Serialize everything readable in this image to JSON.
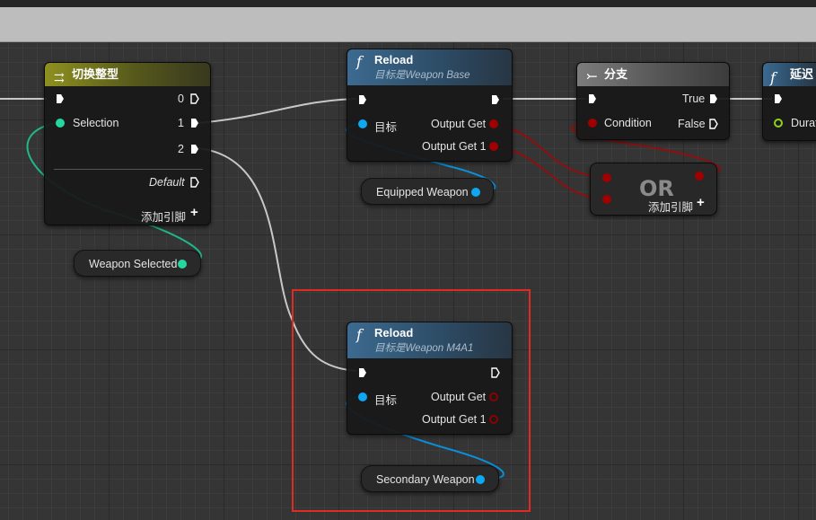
{
  "colors": {
    "exec_pin": "#ffffff",
    "object_pin": "#0fa7f1",
    "int_pin": "#26d6a0",
    "bool_pin": "#a10000",
    "float_pin": "#8bd320",
    "highlight": "#e12a23"
  },
  "switch_node": {
    "icon": "switch-int-icon",
    "title": "切换整型",
    "selection_label": "Selection",
    "out0": "0",
    "out1": "1",
    "out2": "2",
    "default_label": "Default",
    "add_pin_label": "添加引脚"
  },
  "reload_base": {
    "icon": "function-icon",
    "title": "Reload",
    "subtitle": "目标是Weapon Base",
    "target_label": "目标",
    "out_get": "Output Get",
    "out_get1": "Output Get 1"
  },
  "branch_node": {
    "icon": "branch-icon",
    "title": "分支",
    "condition_label": "Condition",
    "true_label": "True",
    "false_label": "False"
  },
  "delay_node": {
    "icon": "function-icon",
    "title": "延迟",
    "duration_label": "Durat"
  },
  "or_node": {
    "label": "OR",
    "add_pin_label": "添加引脚"
  },
  "equipped_weapon": {
    "label": "Equipped Weapon"
  },
  "weapon_selected": {
    "label": "Weapon Selected"
  },
  "reload_m4": {
    "icon": "function-icon",
    "title": "Reload",
    "subtitle": "目标是Weapon M4A1",
    "target_label": "目标",
    "out_get": "Output Get",
    "out_get1": "Output Get 1"
  },
  "secondary_weapon": {
    "label": "Secondary Weapon"
  }
}
